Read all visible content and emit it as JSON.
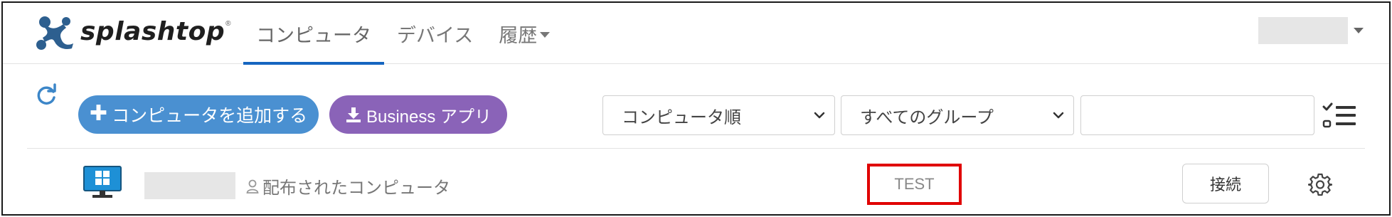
{
  "brand": {
    "name": "splashtop",
    "trademark": "®",
    "icon": "splashtop-logo-icon",
    "color": "#2d5f8f"
  },
  "nav": {
    "tabs": [
      {
        "label": "コンピュータ",
        "active": true
      },
      {
        "label": "デバイス",
        "active": false
      },
      {
        "label": "履歴",
        "active": false,
        "dropdown": true
      }
    ],
    "accent_color": "#1565c0"
  },
  "user_menu": {
    "icon": "chevron-down-icon"
  },
  "toolbar": {
    "refresh_icon": "refresh-icon",
    "add_computer_label": "コンピュータを追加する",
    "add_computer_icon": "plus-icon",
    "add_computer_color": "#4a90d1",
    "business_app_label": "Business アプリ",
    "business_app_icon": "download-icon",
    "business_app_color": "#8a63b8",
    "sort_select": {
      "value": "コンピュータ順"
    },
    "group_select": {
      "value": "すべてのグループ"
    },
    "search": {
      "value": ""
    },
    "list_view_icon": "checklist-icon"
  },
  "computers": [
    {
      "os_icon": "windows-monitor-icon",
      "status": "配布されたコンピュータ",
      "status_icon": "user-icon",
      "tag": "TEST",
      "tag_highlight_color": "#e00000",
      "connect_label": "接続",
      "settings_icon": "gear-icon"
    }
  ]
}
